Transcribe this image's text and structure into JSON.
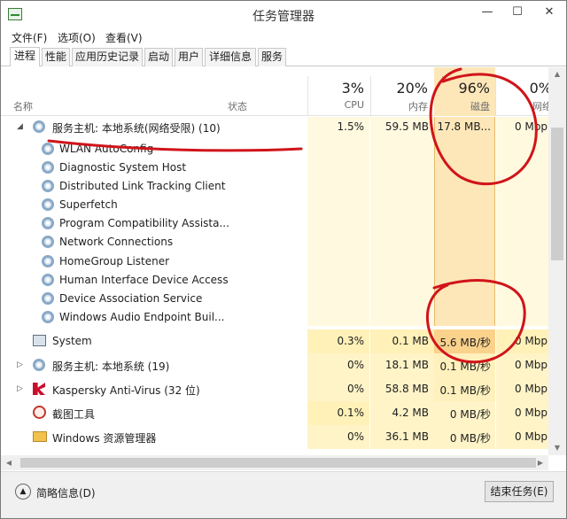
{
  "window": {
    "title": "任务管理器",
    "min": "—",
    "max": "☐",
    "close": "✕"
  },
  "menu": [
    "文件(F)",
    "选项(O)",
    "查看(V)"
  ],
  "tabs": [
    "进程",
    "性能",
    "应用历史记录",
    "启动",
    "用户",
    "详细信息",
    "服务"
  ],
  "header": {
    "name": "名称",
    "status": "状态",
    "cpu_pct": "3%",
    "cpu": "CPU",
    "mem_pct": "20%",
    "mem": "内存",
    "disk_pct": "96%",
    "disk": "磁盘",
    "net_pct": "0%",
    "net": "网络",
    "sort_arrow": "˅"
  },
  "group": {
    "name": "服务主机: 本地系统(网络受限) (10)",
    "cpu": "1.5%",
    "mem": "59.5 MB",
    "disk": "17.8 MB...",
    "net": "0 Mbp"
  },
  "services": [
    "WLAN AutoConfig",
    "Diagnostic System Host",
    "Distributed Link Tracking Client",
    "Superfetch",
    "Program Compatibility Assista...",
    "Network Connections",
    "HomeGroup Listener",
    "Human Interface Device Access",
    "Device Association Service",
    "Windows Audio Endpoint Buil..."
  ],
  "processes": [
    {
      "name": "System",
      "cpu": "0.3%",
      "mem": "0.1 MB",
      "disk": "5.6 MB/秒",
      "net": "0 Mbp"
    },
    {
      "name": "服务主机: 本地系统 (19)",
      "cpu": "0%",
      "mem": "18.1 MB",
      "disk": "0.1 MB/秒",
      "net": "0 Mbp"
    },
    {
      "name": "Kaspersky Anti-Virus (32 位)",
      "cpu": "0%",
      "mem": "58.8 MB",
      "disk": "0.1 MB/秒",
      "net": "0 Mbp"
    },
    {
      "name": "截图工具",
      "cpu": "0.1%",
      "mem": "4.2 MB",
      "disk": "0 MB/秒",
      "net": "0 Mbp"
    },
    {
      "name": "Windows 资源管理器",
      "cpu": "0%",
      "mem": "36.1 MB",
      "disk": "0 MB/秒",
      "net": "0 Mbp"
    }
  ],
  "footer": {
    "fewer_details": "简略信息(D)",
    "end_task": "结束任务(E)"
  },
  "colors": {
    "cpu_bg": "#fff6d1",
    "disk_bg": "#fde7b8",
    "disk_hot": "#fbd28c",
    "annotation": "#d0141a"
  }
}
